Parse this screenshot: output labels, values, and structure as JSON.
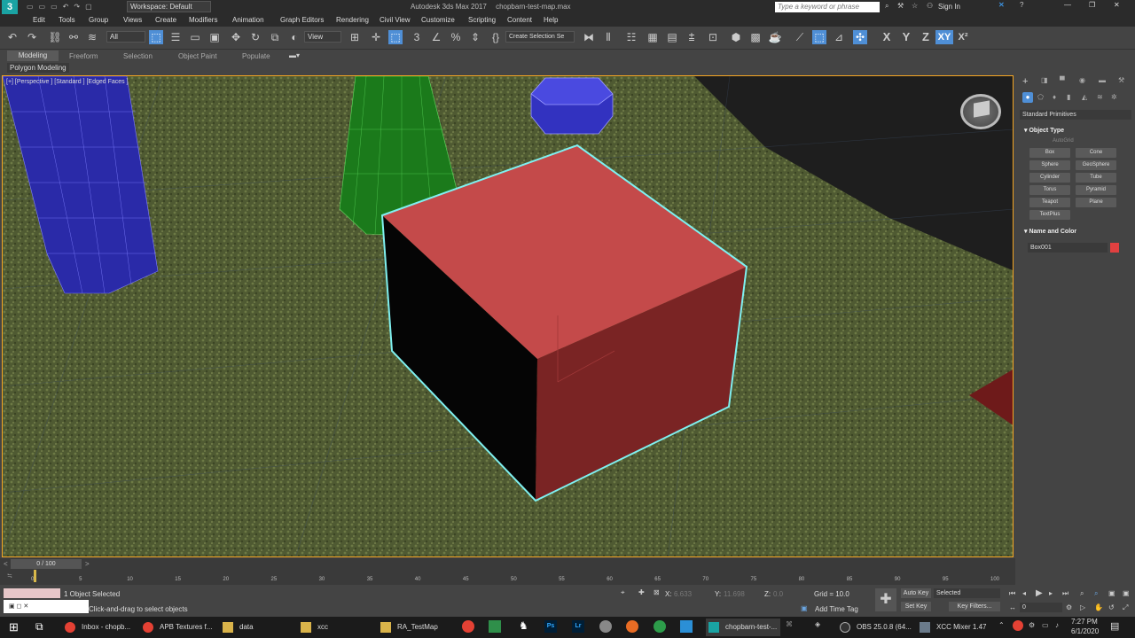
{
  "titlebar": {
    "workspace_label": "Workspace: Default",
    "app_title": "Autodesk 3ds Max 2017",
    "file_name": "chopbarn-test-map.max",
    "search_placeholder": "Type a keyword or phrase",
    "sign_in": "Sign In"
  },
  "menubar": {
    "items": [
      "Edit",
      "Tools",
      "Group",
      "Views",
      "Create",
      "Modifiers",
      "Animation",
      "Graph Editors",
      "Rendering",
      "Civil View",
      "Customize",
      "Scripting",
      "Content",
      "Help"
    ]
  },
  "toolbar": {
    "filter_value": "All",
    "view_value": "View",
    "selection_set_placeholder": "Create Selection Se",
    "axis_labels": [
      "X",
      "Y",
      "Z",
      "XY",
      "X²"
    ]
  },
  "ribbon": {
    "tabs": [
      "Modeling",
      "Freeform",
      "Selection",
      "Object Paint",
      "Populate"
    ],
    "subtitle": "Polygon Modeling"
  },
  "viewport": {
    "label": "[+] [Perspective ] [Standard ] [Edged Faces ]"
  },
  "cmdpanel": {
    "category": "Standard Primitives",
    "object_type_title": "Object Type",
    "autogrid": "AutoGrid",
    "buttons": [
      "Box",
      "Cone",
      "Sphere",
      "GeoSphere",
      "Cylinder",
      "Tube",
      "Torus",
      "Pyramid",
      "Teapot",
      "Plane",
      "TextPlus"
    ],
    "name_color_title": "Name and Color",
    "object_name": "Box001",
    "object_color": "#e04040"
  },
  "timeslider": {
    "frame_label": "0 / 100"
  },
  "trackbar": {
    "ticks": [
      "0",
      "5",
      "10",
      "15",
      "20",
      "25",
      "30",
      "35",
      "40",
      "45",
      "50",
      "55",
      "60",
      "65",
      "70",
      "75",
      "80",
      "85",
      "90",
      "95",
      "100"
    ]
  },
  "statusbar": {
    "selected_text": "1 Object Selected",
    "prompt_text": "Click-and-drag to select objects",
    "x_label": "X:",
    "x_value": "6.633",
    "y_label": "Y:",
    "y_value": "11.698",
    "z_label": "Z:",
    "z_value": "0.0",
    "grid_text": "Grid = 10.0",
    "add_time_tag": "Add Time Tag",
    "auto_key": "Auto Key",
    "selected_dropdown": "Selected",
    "set_key": "Set Key",
    "key_filters": "Key Filters...",
    "frame_value": "0"
  },
  "taskbar": {
    "items": [
      "Inbox - chopb...",
      "APB Textures f...",
      "data",
      "xcc",
      "RA_TestMap",
      "chopbarn-test-...",
      "OBS 25.0.8 (64...",
      "XCC Mixer 1.47"
    ],
    "time": "7:27 PM",
    "date": "6/1/2020"
  },
  "colors": {
    "box_top": "#c44a4a",
    "box_right": "#7a2424",
    "box_left": "#050505",
    "grass": "#4f5a32",
    "cylinder": "#2a2aa8",
    "cone": "#1b7a1b",
    "selection_outline": "#7ff0f0"
  }
}
